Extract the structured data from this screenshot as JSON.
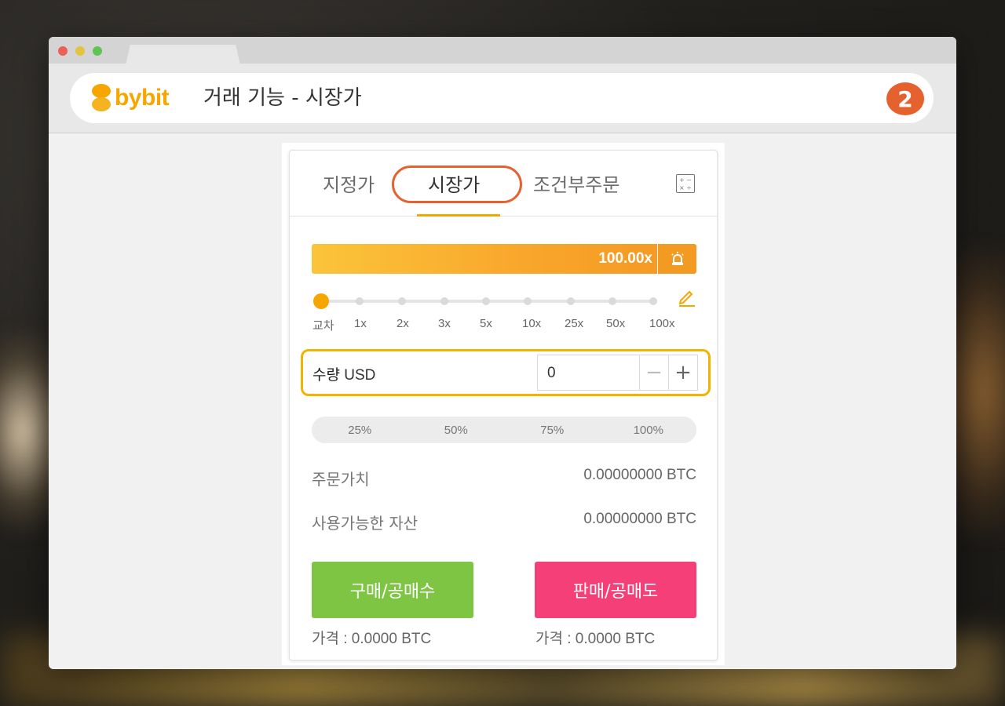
{
  "brand": {
    "logo_text": "bybit",
    "accent": "#f7a600"
  },
  "header": {
    "title": "거래 기능  - 시장가",
    "step_number": "2"
  },
  "order_panel": {
    "tabs": [
      {
        "label": "지정가",
        "active": false
      },
      {
        "label": "시장가",
        "active": true
      },
      {
        "label": "조건부주문",
        "active": false
      }
    ],
    "calculator_icon": "calculator-icon",
    "leverage": {
      "display": "100.00x",
      "level_fraction": 1.0,
      "icon": "alarm-icon"
    },
    "slider": {
      "labels": [
        "교차",
        "1x",
        "2x",
        "3x",
        "5x",
        "10x",
        "25x",
        "50x",
        "100x"
      ],
      "selected": "교차",
      "edit_icon": "pencil-icon"
    },
    "quantity": {
      "label": "수량",
      "unit": "USD",
      "value": "0",
      "minus": "−",
      "plus": "+"
    },
    "percent_options": [
      "25%",
      "50%",
      "75%",
      "100%"
    ],
    "info": [
      {
        "label": "주문가치",
        "value": "0.00000000 BTC"
      },
      {
        "label": "사용가능한 자산",
        "value": "0.00000000 BTC"
      }
    ],
    "buy": {
      "label": "구매/공매수",
      "price_note": "가격 : 0.0000 BTC",
      "color": "#7ec543"
    },
    "sell": {
      "label": "판매/공매도",
      "price_note": "가격 : 0.0000 BTC",
      "color": "#f43f78"
    },
    "highlight_color": "#e5622f",
    "quantity_highlight_color": "#f2b400"
  }
}
